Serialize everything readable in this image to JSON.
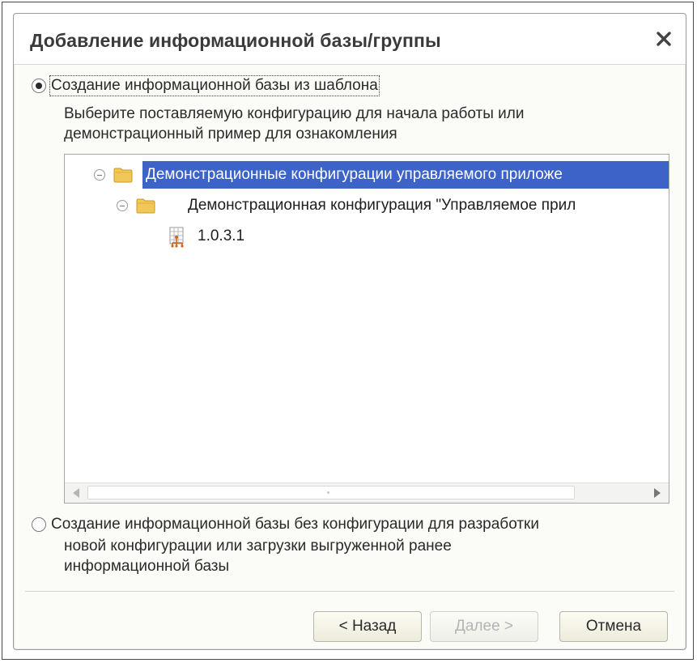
{
  "dialog": {
    "title": "Добавление информационной базы/группы",
    "close_icon": "close-icon"
  },
  "option_template": {
    "label": "Создание информационной базы из шаблона",
    "selected": true,
    "description_line1": "Выберите поставляемую конфигурацию для начала работы или",
    "description_line2": "демонстрационный пример для ознакомления"
  },
  "tree": {
    "items": [
      {
        "label": "Демонстрационные конфигурации управляемого приложе",
        "icon": "folder-icon",
        "expanded": true,
        "selected": true,
        "level": 0
      },
      {
        "label": "Демонстрационная конфигурация \"Управляемое прил",
        "icon": "folder-icon",
        "expanded": true,
        "selected": false,
        "level": 1
      },
      {
        "label": "1.0.3.1",
        "icon": "configuration-icon",
        "selected": false,
        "level": 2
      }
    ]
  },
  "option_empty": {
    "label": "Создание информационной базы без конфигурации для разработки",
    "line2": "новой конфигурации или загрузки выгруженной ранее",
    "line3": "информационной базы",
    "selected": false
  },
  "buttons": {
    "back": "< Назад",
    "next": "Далее >",
    "cancel": "Отмена"
  },
  "colors": {
    "selection": "#3d63c8",
    "folder": "#f1c757"
  }
}
